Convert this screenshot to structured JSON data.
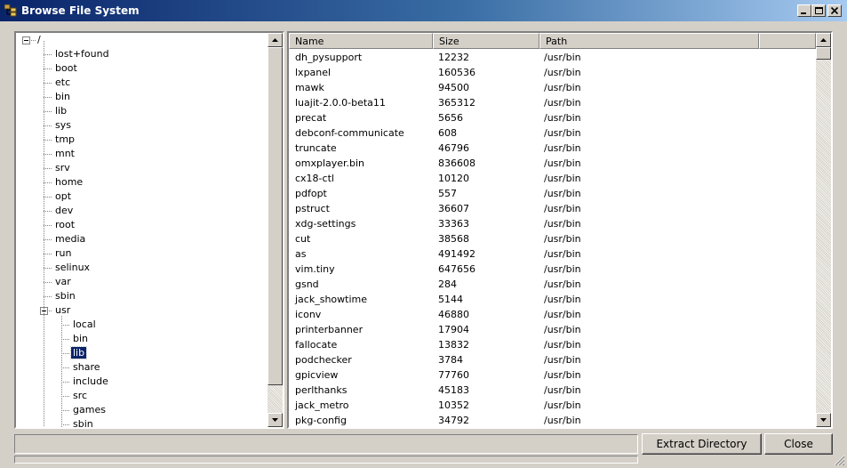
{
  "window": {
    "title": "Browse File System"
  },
  "tree": {
    "root": "/",
    "items": [
      "lost+found",
      "boot",
      "etc",
      "bin",
      "lib",
      "sys",
      "tmp",
      "mnt",
      "srv",
      "home",
      "opt",
      "dev",
      "root",
      "media",
      "run",
      "selinux",
      "var",
      "sbin"
    ],
    "expanded": "usr",
    "children": [
      "local",
      "bin",
      "lib",
      "share",
      "include",
      "src",
      "games",
      "sbin"
    ],
    "selected": "lib"
  },
  "list": {
    "columns": [
      "Name",
      "Size",
      "Path"
    ],
    "rows": [
      [
        "dh_pysupport",
        "12232",
        "/usr/bin"
      ],
      [
        "lxpanel",
        "160536",
        "/usr/bin"
      ],
      [
        "mawk",
        "94500",
        "/usr/bin"
      ],
      [
        "luajit-2.0.0-beta11",
        "365312",
        "/usr/bin"
      ],
      [
        "precat",
        "5656",
        "/usr/bin"
      ],
      [
        "debconf-communicate",
        "608",
        "/usr/bin"
      ],
      [
        "truncate",
        "46796",
        "/usr/bin"
      ],
      [
        "omxplayer.bin",
        "836608",
        "/usr/bin"
      ],
      [
        "cx18-ctl",
        "10120",
        "/usr/bin"
      ],
      [
        "pdfopt",
        "557",
        "/usr/bin"
      ],
      [
        "pstruct",
        "36607",
        "/usr/bin"
      ],
      [
        "xdg-settings",
        "33363",
        "/usr/bin"
      ],
      [
        "cut",
        "38568",
        "/usr/bin"
      ],
      [
        "as",
        "491492",
        "/usr/bin"
      ],
      [
        "vim.tiny",
        "647656",
        "/usr/bin"
      ],
      [
        "gsnd",
        "284",
        "/usr/bin"
      ],
      [
        "jack_showtime",
        "5144",
        "/usr/bin"
      ],
      [
        "iconv",
        "46880",
        "/usr/bin"
      ],
      [
        "printerbanner",
        "17904",
        "/usr/bin"
      ],
      [
        "fallocate",
        "13832",
        "/usr/bin"
      ],
      [
        "podchecker",
        "3784",
        "/usr/bin"
      ],
      [
        "gpicview",
        "77760",
        "/usr/bin"
      ],
      [
        "perlthanks",
        "45183",
        "/usr/bin"
      ],
      [
        "jack_metro",
        "10352",
        "/usr/bin"
      ],
      [
        "pkg-config",
        "34792",
        "/usr/bin"
      ]
    ]
  },
  "buttons": {
    "extract": "Extract Directory",
    "close": "Close"
  },
  "status": {
    "text": ""
  },
  "icons": {
    "app": "folder-tree-icon",
    "minimize": "minimize-icon",
    "maximize": "maximize-icon",
    "close": "close-icon"
  }
}
